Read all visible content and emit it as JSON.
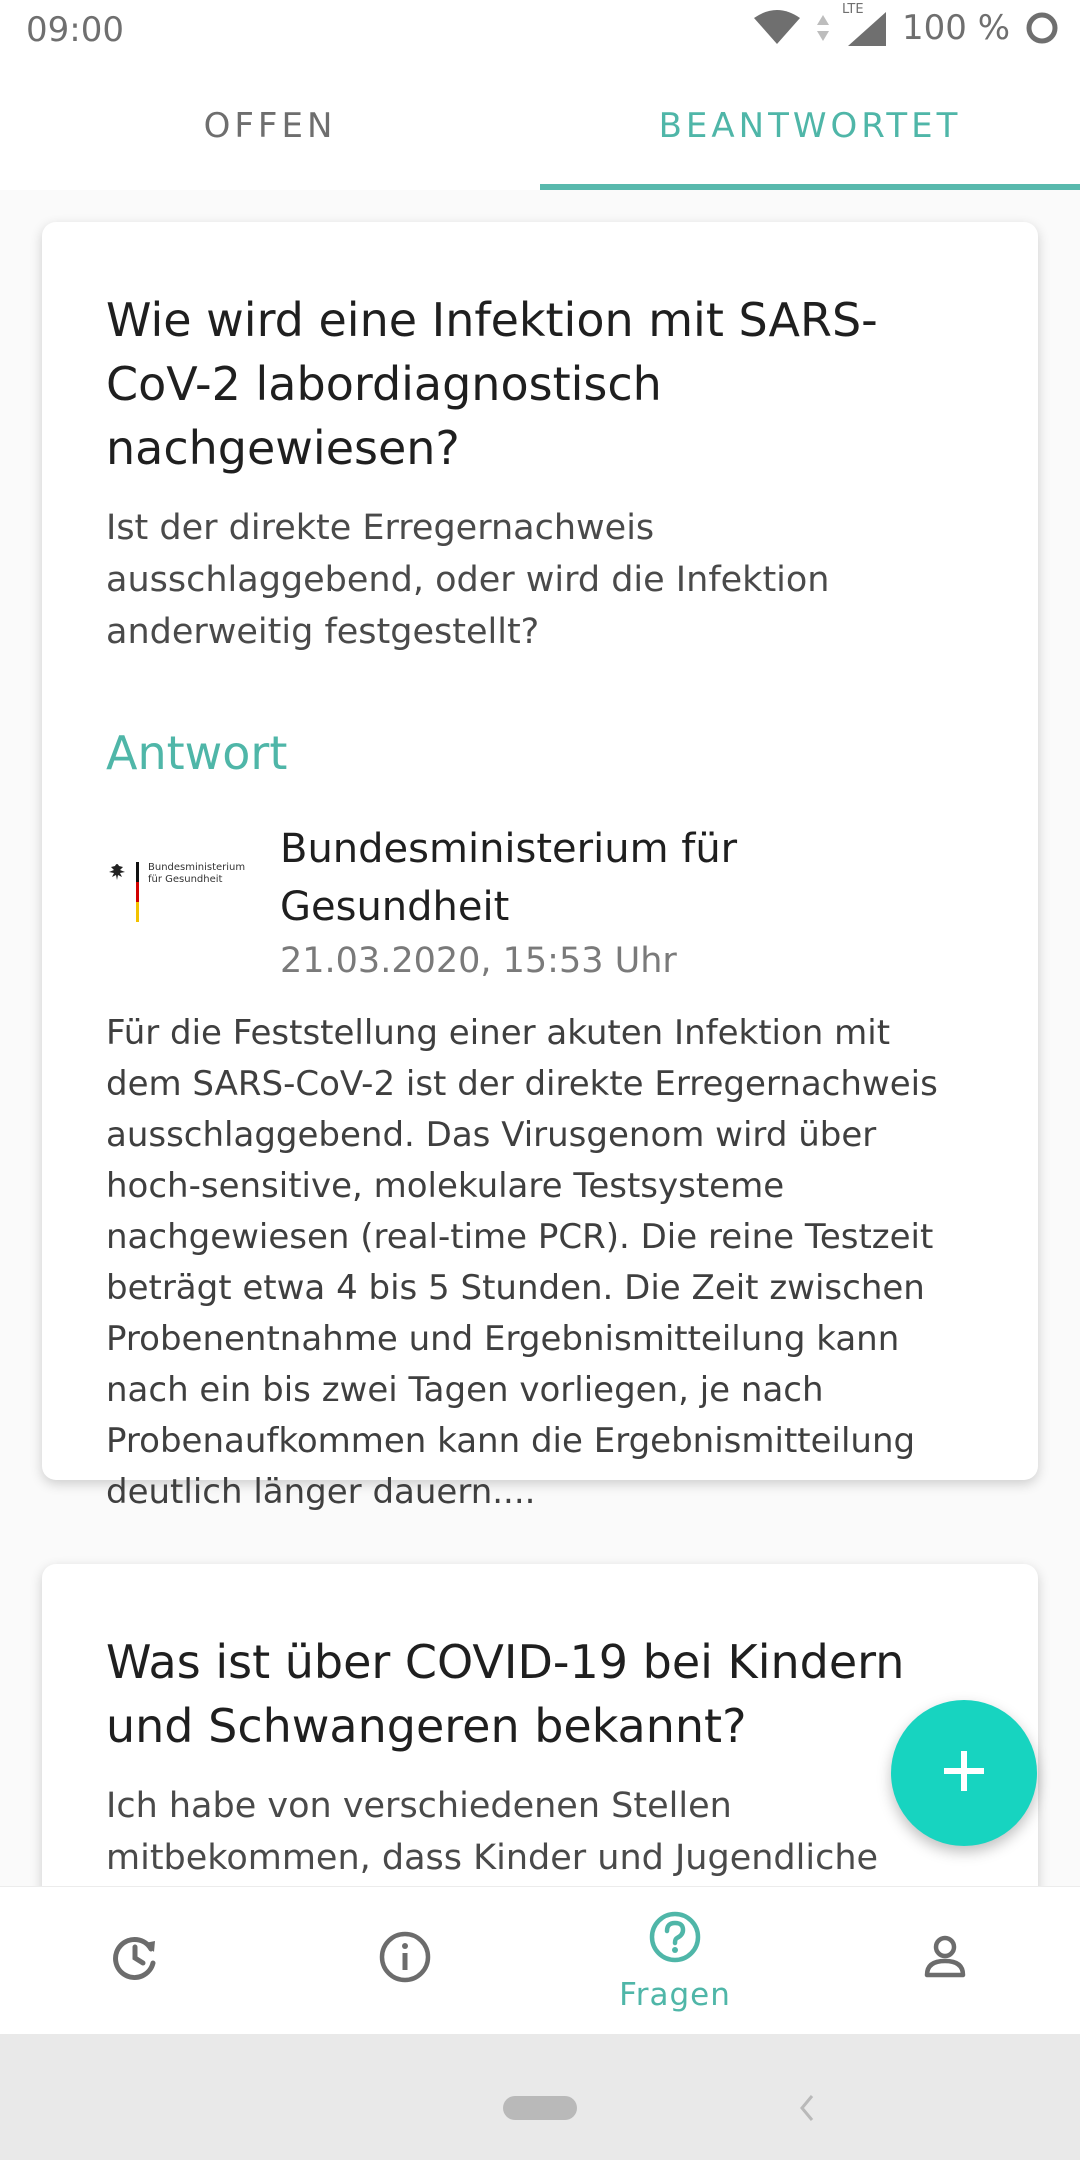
{
  "status_bar": {
    "time": "09:00",
    "network": "LTE",
    "battery": "100 %"
  },
  "tabs": [
    {
      "label": "OFFEN",
      "active": false
    },
    {
      "label": "BEANTWORTET",
      "active": true
    }
  ],
  "cards": [
    {
      "title": "Wie wird eine Infektion mit SARS-CoV-2 labordiagnostisch nachgewiesen?",
      "subtitle": "Ist der direkte Erregernachweis ausschlaggebend, oder wird die Infektion anderweitig festgestellt?",
      "answer_label": "Antwort",
      "author": {
        "logo_text_line1": "Bundesministerium",
        "logo_text_line2": "für Gesundheit",
        "name": "Bundesministerium für Gesundheit",
        "timestamp": "21.03.2020, 15:53 Uhr"
      },
      "answer": "Für die Feststellung einer akuten Infektion mit dem SARS-CoV-2 ist der direkte Erregernachweis ausschlaggebend. Das Virusgenom wird über hoch-sensitive, molekulare Testsysteme nachgewiesen (real-time PCR). Die reine Testzeit beträgt etwa 4 bis 5 Stunden. Die Zeit zwischen Probenentnahme und Ergebnismitteilung kann nach ein bis zwei Tagen vorliegen, je nach Probenaufkommen kann die Ergebnismitteilung deutlich länger dauern...."
    },
    {
      "title": "Was ist über COVID-19 bei Kindern und Schwangeren bekannt?",
      "subtitle": "Ich habe von verschiedenen Stellen mitbekommen, dass Kinder und Jugendliche nicht"
    }
  ],
  "fab": {
    "icon": "plus-icon",
    "color": "#17d4c0"
  },
  "bottom_nav": [
    {
      "icon": "history-icon",
      "label": "",
      "active": false
    },
    {
      "icon": "info-icon",
      "label": "",
      "active": false
    },
    {
      "icon": "question-icon",
      "label": "Fragen",
      "active": true
    },
    {
      "icon": "person-icon",
      "label": "",
      "active": false
    }
  ],
  "colors": {
    "accent": "#4fb6a8",
    "fab": "#17d4c0"
  }
}
